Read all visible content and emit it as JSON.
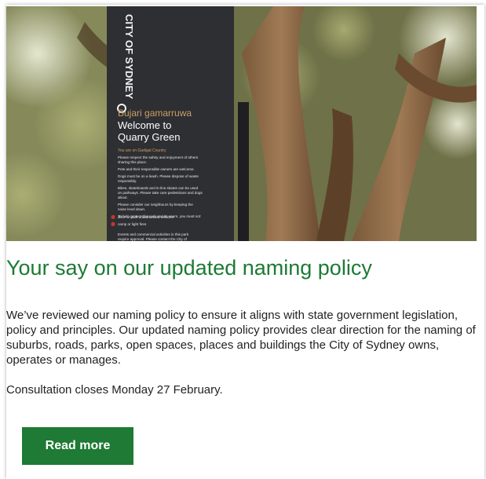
{
  "hero": {
    "logo_text": "CITY OF SYDNEY",
    "sign": {
      "indigenous_title": "Bujari gamarruwa",
      "welcome_line1": "Welcome to",
      "welcome_line2": "Quarry Green",
      "country_line": "You are on Gadigal Country",
      "rules": [
        "Please respect the safety and enjoyment of others",
        "sharing this place.",
        "Pets and their responsible owners are welcome.",
        "Dogs must be on a leash. Please dispose of waste",
        "responsibly.",
        "Bikes, skateboards and in-line skates can be used",
        "on pathways. Please take care pedestrians and dogs",
        "about.",
        "Please consider our neighbours by keeping the",
        "noise level down.",
        "To help protect this park and its users, you must not:"
      ],
      "prohibited": [
        "drive or park unauthorised vehicles",
        "camp or light fires"
      ],
      "footer_lines": [
        "Events and commercial activities in this park",
        "require approval. Please contact the City of"
      ]
    },
    "colors": {
      "sign_panel": "#2e2f33",
      "sign_accent": "#c9a066"
    }
  },
  "article": {
    "headline": "Your say on our updated naming policy",
    "body": "We’ve reviewed our naming policy to ensure it aligns with state government legislation, policy and principles. Our updated naming policy provides clear direction for the naming of suburbs, roads, parks, open spaces, places and buildings the City of Sydney owns, operates or manages.",
    "closing": "Consultation closes Monday 27 February."
  },
  "cta": {
    "label": "Read more"
  },
  "colors": {
    "brand_green": "#1e7a34",
    "text": "#222222"
  }
}
